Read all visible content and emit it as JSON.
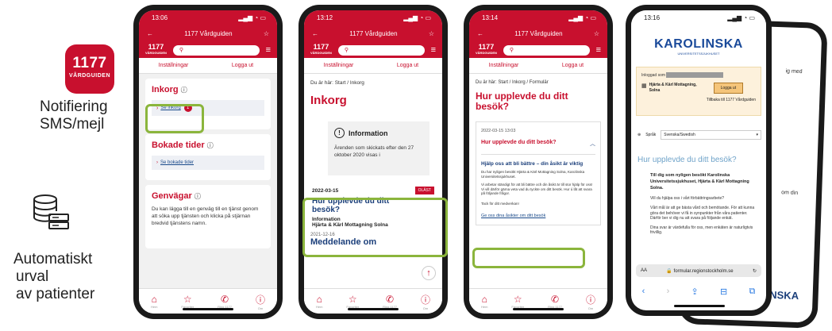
{
  "legend": {
    "app_icon_number": "1177",
    "app_icon_sub": "VÅRDGUIDEN",
    "notification_line1": "Notifiering",
    "notification_line2": "SMS/mejl",
    "auto_line1": "Automatiskt",
    "auto_line2": "urval",
    "auto_line3": "av patienter"
  },
  "phone1": {
    "time": "13:06",
    "title": "1177 Vårdguiden",
    "logo": "1177",
    "logo_sub": "VÅRDGUIDEN",
    "tab_settings": "Inställningar",
    "tab_logout": "Logga ut",
    "inbox_title": "Inkorg",
    "inbox_link": "Se inkorg",
    "badge": "1",
    "booked_title": "Bokade tider",
    "booked_link": "Se bokade tider",
    "shortcuts_title": "Genvägar",
    "shortcuts_text": "Du kan lägga till en genväg till en tjänst genom att söka upp tjänsten och klicka på stjärnan bredvid tjänstens namn."
  },
  "phone2": {
    "time": "13:12",
    "title": "1177 Vårdguiden",
    "logo": "1177",
    "tab_settings": "Inställningar",
    "tab_logout": "Logga ut",
    "breadcrumb": "Du är här: Start / Inkorg",
    "heading": "Inkorg",
    "info_title": "Information",
    "info_text": "Ärenden som skickats efter den 27 oktober 2020 visas i",
    "msg_date": "2022-03-15",
    "msg_badge": "OLÄST",
    "msg_title": "Hur upplevde du ditt besök?",
    "msg_from_label": "Information",
    "msg_from": "Hjärta & Kärl Mottagning Solna",
    "msg2_date": "2021-12-16",
    "msg2_title": "Meddelande om"
  },
  "phone3": {
    "time": "13:14",
    "title": "1177 Vårdguiden",
    "logo": "1177",
    "tab_settings": "Inställningar",
    "tab_logout": "Logga ut",
    "breadcrumb": "Du är här: Start / Inkorg / Formulär",
    "heading": "Hur upplevde du ditt besök?",
    "date": "2022-03-15 13:03",
    "sub_heading": "Hur upplevde du ditt besök?",
    "help_title": "Hjälp oss att bli bättre – din åsikt är viktig",
    "body1": "Du har nyligen besökt Hjärta & Kärl Mottagning Solna, Karolinska Universitetssjukhuset.",
    "body2": "Vi arbetar ständigt för att bli bättre och din åsikt är till stor hjälp för oss! Vi vill därför gärna veta vad du tyckte om ditt besök. Hur ú låt att svara på följande frågor.",
    "thanks": "Tack för ditt medverkan!",
    "link": "Ge oss dina åsikter om ditt besök"
  },
  "phone4": {
    "time": "13:16",
    "brand": "KAROLINSKA",
    "brand_sub": "UNIVERSITETSSJUKHUSET",
    "logged_in": "Inloggad som",
    "unit": "Hjärta & Kärl Mottagning, Solna",
    "logout": "Logga ut",
    "back": "Tillbaka till 1177 Vårdguiden",
    "lang_label": "Språk",
    "lang_value": "Svenska/Swedish",
    "heading": "Hur upplevde du ditt besök?",
    "intro": "Till dig som nyligen besökt Karolinska Universitetssjukhuset, Hjärta & Kärl Mottagning Solna.",
    "help": "Vill du hjälpa oss i vårt förbättringsarbete?",
    "text1": "Vårt mål är att ge bästa vård och bemötande. För att kunna göra det behöver vi få in synpunkter från våra patienter. Därför ber vi dig nu att svara på följande enkät.",
    "text2": "Dina svar är värdefulla för oss, men enkäten är naturligtvis frivillig.",
    "url": "formular.regionstockholm.se",
    "aa": "AA"
  },
  "phone5": {
    "frag1": "ig med",
    "frag2": "om din",
    "brand_frag": "INSKA"
  }
}
